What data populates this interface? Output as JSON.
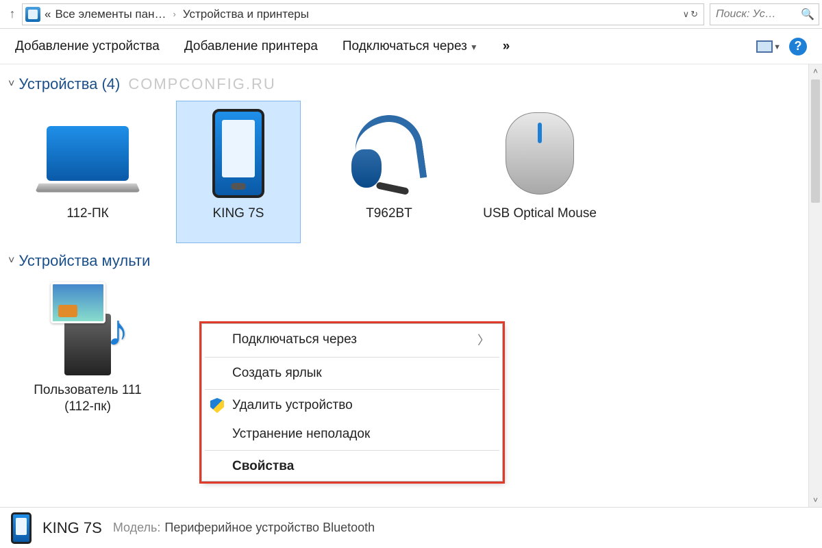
{
  "addressbar": {
    "parent": "Все элементы пан…",
    "current": "Устройства и принтеры"
  },
  "search": {
    "placeholder": "Поиск: Ус…"
  },
  "toolbar": {
    "add_device": "Добавление устройства",
    "add_printer": "Добавление принтера",
    "connect_via": "Подключаться через",
    "more": "»"
  },
  "sections": {
    "devices": {
      "title": "Устройства",
      "count": "(4)"
    },
    "multimedia": {
      "title": "Устройства мульти"
    }
  },
  "watermark": "COMPCONFIG.RU",
  "devices": [
    {
      "label": "112-ПК"
    },
    {
      "label": "KING 7S"
    },
    {
      "label": "T962BT"
    },
    {
      "label": "USB Optical Mouse"
    }
  ],
  "multimedia_devices": [
    {
      "label": "Пользователь 111 (112-пк)"
    }
  ],
  "context_menu": {
    "connect_via": "Подключаться через",
    "create_shortcut": "Создать ярлык",
    "remove_device": "Удалить устройство",
    "troubleshoot": "Устранение неполадок",
    "properties": "Свойства"
  },
  "details": {
    "name": "KING 7S",
    "model_label": "Модель:",
    "model_value": "Периферийное устройство Bluetooth"
  }
}
